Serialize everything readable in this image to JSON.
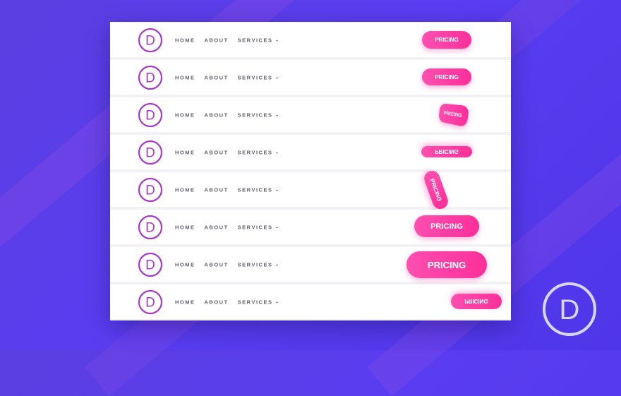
{
  "colors": {
    "background": "#5a3df0",
    "stripe": "#8a4ae6",
    "panel": "#f2f2f6",
    "row": "#ffffff",
    "logo": "#a63bc9",
    "nav_text": "#5e5e6e",
    "pricing": "#ff2f9a",
    "watermark": "#d8d6f2"
  },
  "nav": {
    "home": "HOME",
    "about": "ABOUT",
    "services": "SERVICES",
    "services_chevron": "chevron-down-icon"
  },
  "logo": {
    "letter": "D",
    "icon": "divi-logo-icon"
  },
  "pricing_label": "PRICING",
  "rows": [
    {
      "pricing": "PRICING"
    },
    {
      "pricing": "PRICING"
    },
    {
      "pricing": "PRICING"
    },
    {
      "pricing": "PRICING"
    },
    {
      "pricing": "PRICING"
    },
    {
      "pricing": "PRICING"
    },
    {
      "pricing": "PRICING"
    },
    {
      "pricing": "PRICING"
    }
  ],
  "watermark": {
    "letter": "D",
    "icon": "divi-watermark-icon"
  }
}
